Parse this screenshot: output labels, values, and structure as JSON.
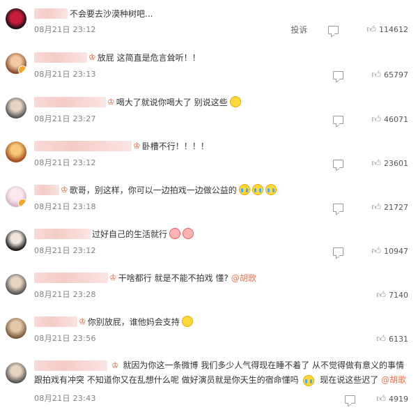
{
  "comments": [
    {
      "text": "不会要去沙漠种树吧...",
      "time": "08月21日 23:12",
      "likes": "114612",
      "report": "投诉"
    },
    {
      "text": "放屁 这简直是危言耸听！！",
      "time": "08月21日 23:13",
      "likes": "65797"
    },
    {
      "text": "喝大了就说你喝大了 别说这些",
      "time": "08月21日 23:27",
      "likes": "46071"
    },
    {
      "text": "卧槽不行！！！！",
      "time": "08月21日 23:12",
      "likes": "23601"
    },
    {
      "text": "歌哥，别这样，你可以一边拍戏一边做公益的",
      "time": "08月21日 23:18",
      "likes": "21727"
    },
    {
      "text": "过好自己的生活就行",
      "time": "08月21日 23:12",
      "likes": "10947"
    },
    {
      "text": "干啥都行 就是不能不拍戏 懂?",
      "mention": "@胡歌",
      "time": "08月21日 23:28",
      "likes": "7140"
    },
    {
      "text": "你别放屁，谁他妈会支持",
      "time": "08月21日 23:56",
      "likes": "6131"
    },
    {
      "text": "就因为你这一条微博 我们多少人气得现在睡不着了 从不觉得做有意义的事情跟拍戏有冲突 不知道你又在乱想什么呢 做好演员就是你天生的宿命懂吗",
      "text2": "现在说这些迟了",
      "mention": "@胡歌",
      "time": "08月21日 23:43",
      "likes": "4919"
    }
  ],
  "colors": {
    "mention": "#eb7350",
    "time": "#808080",
    "badge": "#f5a623"
  }
}
